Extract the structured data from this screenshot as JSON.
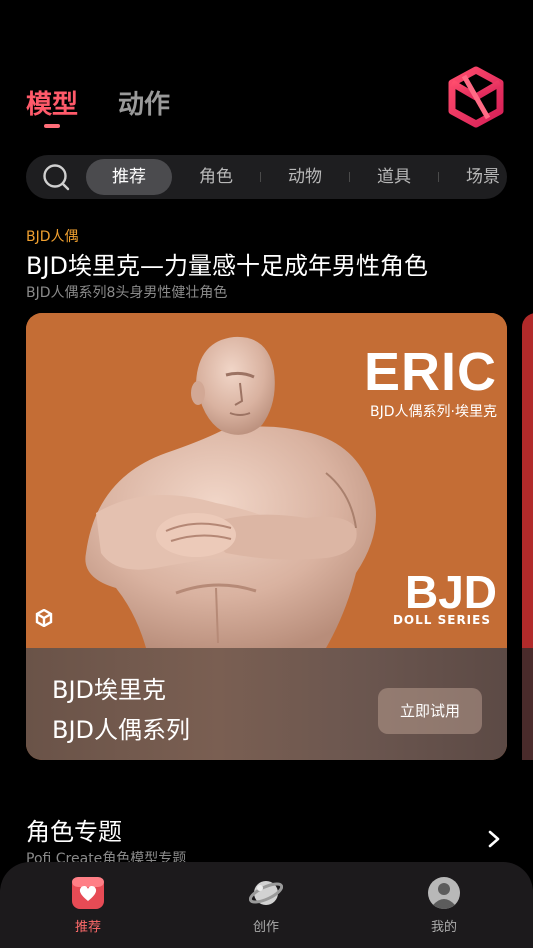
{
  "top_tabs": [
    {
      "label": "模型",
      "active": true
    },
    {
      "label": "动作",
      "active": false
    }
  ],
  "categories": [
    {
      "label": "推荐",
      "active": true
    },
    {
      "label": "角色",
      "active": false
    },
    {
      "label": "动物",
      "active": false
    },
    {
      "label": "道具",
      "active": false
    },
    {
      "label": "场景",
      "active": false
    }
  ],
  "feature": {
    "tag": "BJD人偶",
    "title": "BJD埃里克—力量感十足成年男性角色",
    "subtitle": "BJD人偶系列8头身男性健壮角色"
  },
  "card": {
    "art_title": "ERIC",
    "art_subtitle": "BJD人偶系列·埃里克",
    "brand": "BJD",
    "brand_sub": "DOLL SERIES",
    "name": "BJD埃里克",
    "series": "BJD人偶系列",
    "try_label": "立即试用"
  },
  "section": {
    "title": "角色专题",
    "subtitle": "Pofi Create角色模型专题"
  },
  "bottom_nav": [
    {
      "label": "推荐",
      "icon": "recommend-icon",
      "active": true
    },
    {
      "label": "创作",
      "icon": "planet-icon",
      "active": false
    },
    {
      "label": "我的",
      "icon": "avatar-icon",
      "active": false
    }
  ],
  "colors": {
    "accent": "#ff5a6a",
    "tag": "#f0a030",
    "card_bg": "#c06a33"
  }
}
